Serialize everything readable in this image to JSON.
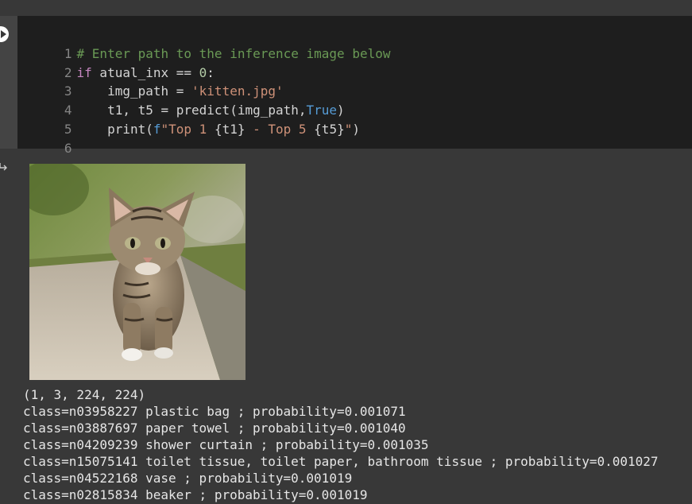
{
  "cell": {
    "line_numbers": [
      "1",
      "2",
      "3",
      "4",
      "5",
      "6"
    ],
    "comment": "# Enter path to the inference image below",
    "kw_if": "if",
    "if_rest": " atual_inx == ",
    "zero": "0",
    "colon": ":",
    "indent_img": "    img_path = ",
    "img_value": "'kitten.jpg'",
    "indent_pred": "    t1, t5 = predict(img_path,",
    "true_kw": "True",
    "close_paren": ")",
    "indent_print": "    print(",
    "f_prefix": "f",
    "fstr_a": "\"Top 1 ",
    "interp_t1": "{t1}",
    "fstr_b": " - Top 5 ",
    "interp_t5": "{t5}",
    "fstr_c": "\"",
    "print_close": ")"
  },
  "output": {
    "shape": "(1, 3, 224, 224)",
    "results": [
      "class=n03958227 plastic bag ; probability=0.001071",
      "class=n03887697 paper towel ; probability=0.001040",
      "class=n04209239 shower curtain ; probability=0.001035",
      "class=n15075141 toilet tissue, toilet paper, bathroom tissue ; probability=0.001027",
      "class=n04522168 vase ; probability=0.001019",
      "class=n02815834 beaker ; probability=0.001019"
    ]
  },
  "icons": {
    "run": "play-circle-icon",
    "output": "output-arrow-icon"
  },
  "colors": {
    "background": "#383838",
    "editor_bg": "#1e1e1e",
    "comment": "#6a9955",
    "keyword": "#c586c0",
    "string": "#ce9178",
    "builtin": "#569cd6",
    "number": "#b5cea8"
  }
}
